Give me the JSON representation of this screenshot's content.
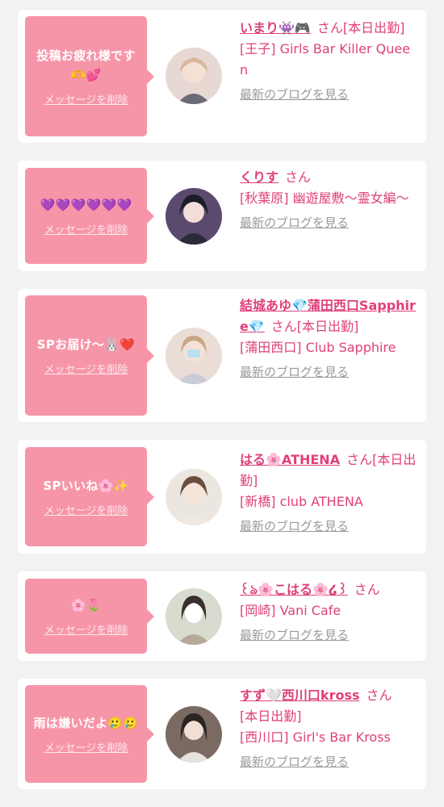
{
  "delete_label": "メッセージを削除",
  "blog_label": "最新のブログを見る",
  "honorific": "さん",
  "avatar_kind": "profile-photo",
  "colors": {
    "accent": "#e0407a",
    "bubble": "#f795a8",
    "muted": "#9a9a9a"
  },
  "cards": [
    {
      "message": "投稿お疲れ様です🫶💕",
      "name": "いまり👾🎮",
      "status": "[本日出勤]",
      "shop": "[王子] Girls Bar Killer Queen"
    },
    {
      "message": "💜💜💜💜💜💜",
      "name": "くりす",
      "status": "",
      "shop": "[秋葉原] 幽遊屋敷～霊女編～"
    },
    {
      "message": "SPお届け～🐰❤️",
      "name": "結城あゆ💎蒲田西口Sapphire💎",
      "status": "[本日出勤]",
      "shop": "[蒲田西口] Club Sapphire"
    },
    {
      "message": "SPいいね🌸✨",
      "name": "はる🌸ATHENA",
      "status": "[本日出勤]",
      "shop": "[新橋] club ATHENA"
    },
    {
      "message": "🌸🌷",
      "name": "꒰ঌ🌸こはる🌸໒꒱",
      "status": "",
      "shop": "[岡崎] Vani Cafe"
    },
    {
      "message": "雨は嫌いだよ🥲🥲",
      "name": "すず🤍西川口kross",
      "status": "[本日出勤]",
      "shop": "[西川口] Girl's Bar Kross"
    }
  ]
}
